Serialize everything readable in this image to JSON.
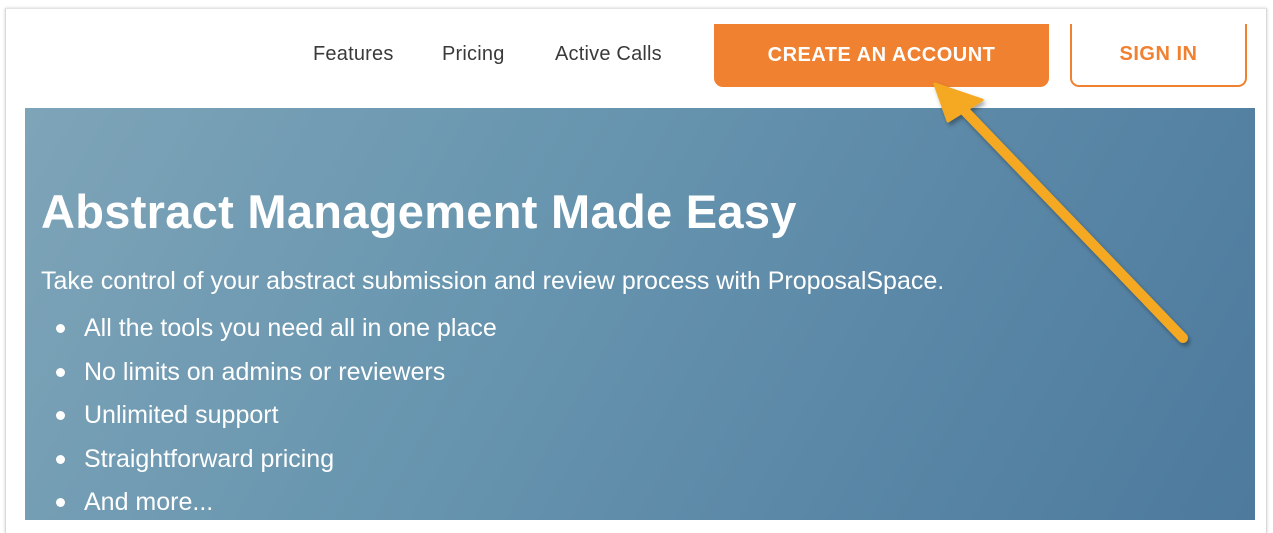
{
  "nav": {
    "links": [
      {
        "label": "Features"
      },
      {
        "label": "Pricing"
      },
      {
        "label": "Active Calls"
      }
    ],
    "create_account_label": "CREATE AN ACCOUNT",
    "sign_in_label": "SIGN IN"
  },
  "hero": {
    "title": "Abstract Management Made Easy",
    "subtitle": "Take control of your abstract submission and review process with ProposalSpace.",
    "bullets": [
      "All the tools you need all in one place",
      "No limits on admins or reviewers",
      "Unlimited support",
      "Straightforward pricing",
      "And more..."
    ]
  },
  "annotation": {
    "icon": "arrow-pointer-icon",
    "target": "create-account-button"
  },
  "colors": {
    "accent": "#f08130",
    "hero_bg_start": "#7ea4b8",
    "hero_bg_end": "#4d7a9d",
    "arrow": "#f5a921",
    "nav_text": "#3a3a3a"
  }
}
